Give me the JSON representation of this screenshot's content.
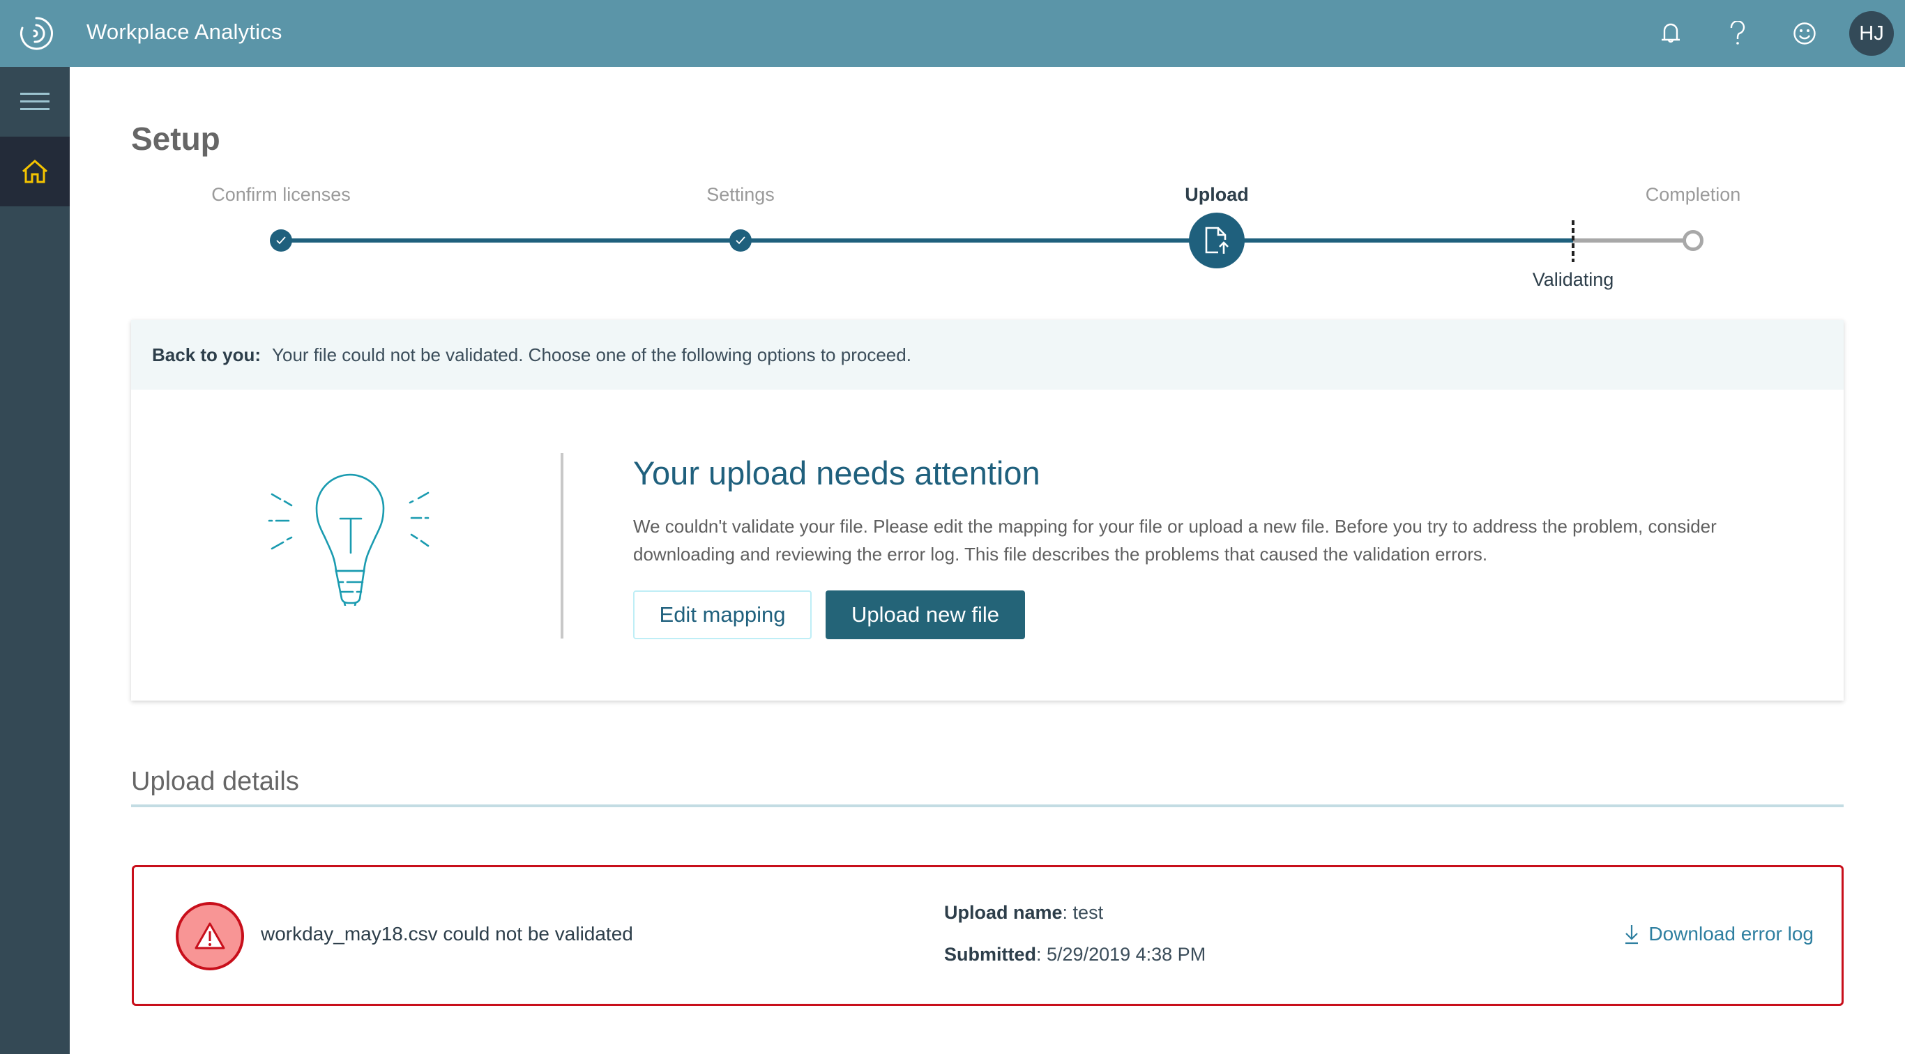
{
  "header": {
    "app_title": "Workplace Analytics",
    "icons": [
      "notifications-bell-icon",
      "help-question-icon",
      "feedback-smiley-icon"
    ],
    "avatar_initials": "HJ"
  },
  "sidebar": {
    "items": [
      {
        "name": "menu",
        "icon": "hamburger-menu-icon"
      },
      {
        "name": "home",
        "icon": "home-icon",
        "active": true
      }
    ]
  },
  "page": {
    "title": "Setup"
  },
  "stepper": {
    "steps": [
      {
        "label": "Confirm licenses",
        "state": "complete"
      },
      {
        "label": "Settings",
        "state": "complete"
      },
      {
        "label": "Upload",
        "state": "current"
      },
      {
        "label": "Completion",
        "state": "pending"
      }
    ],
    "substatus_label": "Validating",
    "colors": {
      "complete": "#1f607d",
      "pending": "#a8a8a8"
    }
  },
  "alert": {
    "prefix": "Back to you:",
    "message": "Your file could not be validated. Choose one of the following options to proceed."
  },
  "attention": {
    "title": "Your upload needs attention",
    "body": "We couldn't validate your file. Please edit the mapping for your file or upload a new file. Before you try to address the problem, consider downloading and reviewing the error log. This file describes the problems that caused the validation errors.",
    "edit_button": "Edit mapping",
    "upload_button": "Upload new file"
  },
  "upload_details": {
    "section_title": "Upload details",
    "error_message": "workday_may18.csv could not be validated",
    "upload_name_label": "Upload name",
    "upload_name_value": "test",
    "submitted_label": "Submitted",
    "submitted_value": "5/29/2019 4:38 PM",
    "download_link": "Download error log",
    "error_color": "#c80f1b"
  }
}
